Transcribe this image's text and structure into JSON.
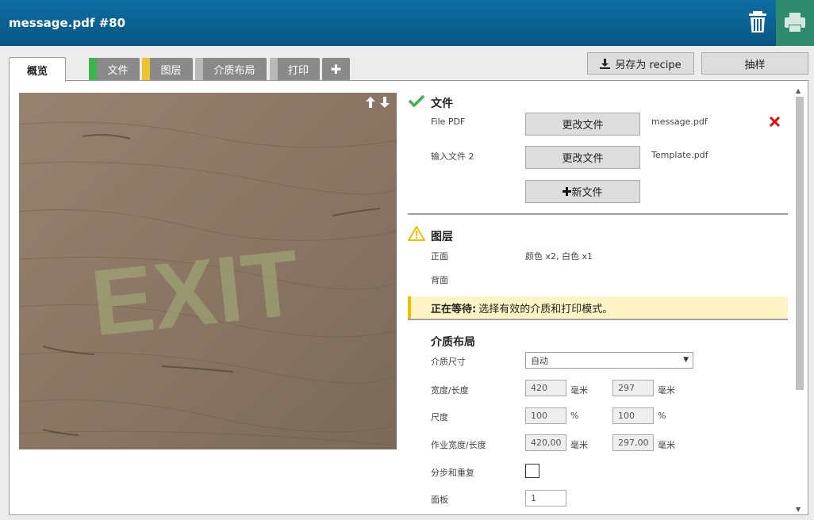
{
  "header": {
    "title": "message.pdf #80"
  },
  "tabs": [
    {
      "label": "概览",
      "strip": ""
    },
    {
      "label": "文件",
      "strip": "#3cb44b"
    },
    {
      "label": "图层",
      "strip": "#f2c12e"
    },
    {
      "label": "介质布局",
      "strip": "#b9b9b9"
    },
    {
      "label": "打印",
      "strip": "#b9b9b9"
    },
    {
      "label": "✚",
      "strip": ""
    }
  ],
  "toolbar": {
    "save_recipe": "另存为 recipe",
    "sample": "抽样"
  },
  "preview": {
    "overlay_text": "EXIT"
  },
  "file_section": {
    "title": "文件",
    "rows": [
      {
        "label": "File PDF",
        "button": "更改文件",
        "filename": "message.pdf"
      },
      {
        "label": "输入文件 2",
        "button": "更改文件",
        "filename": "Template.pdf"
      }
    ],
    "new_file": "新文件"
  },
  "layers_section": {
    "title": "图层",
    "front_label": "正面",
    "front_value": "颜色 x2, 白色 x1",
    "back_label": "背面"
  },
  "status": {
    "bold": "正在等待:",
    "text": "选择有效的介质和打印模式。"
  },
  "media_section": {
    "title": "介质布局",
    "media_size_label": "介质尺寸",
    "media_size_value": "自动",
    "width_length_label": "宽度/长度",
    "width": "420",
    "length": "297",
    "unit_mm": "毫米",
    "scale_label": "尺度",
    "scale_x": "100",
    "scale_y": "100",
    "unit_pct": "%",
    "job_size_label": "作业宽度/长度",
    "job_width": "420,00",
    "job_length": "297,00",
    "step_repeat_label": "分步和重复",
    "panel_label": "面板",
    "panel_value": "1"
  },
  "colors": {
    "header": "#0a6497",
    "accent_green": "#3cb44b",
    "warning": "#f0c000",
    "delete_red": "#e01010"
  }
}
